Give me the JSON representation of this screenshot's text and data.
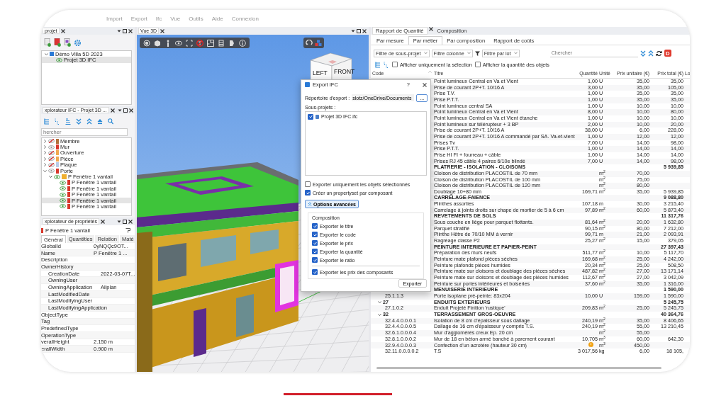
{
  "menu": [
    "Import",
    "Export",
    "Ifc",
    "Vue",
    "Outils",
    "Aide",
    "Connexion"
  ],
  "project_panel": {
    "tab": "projet",
    "tree": [
      {
        "label": "Démo Villa 5D 2023",
        "expanded": true,
        "selected": false,
        "children": [
          {
            "label": "Projet 3D IFC",
            "selected": true
          }
        ]
      }
    ]
  },
  "ifc_explorer": {
    "tab": "xplorateur IFC - Projet 3D ...",
    "search": {
      "placeholder": "hercher"
    },
    "tree": [
      {
        "label": "Membre",
        "visible": false,
        "color": "#b0703a",
        "expanded": false,
        "selected": false
      },
      {
        "label": "Mur",
        "visible": true,
        "color": "#d8382c",
        "expanded": false,
        "selected": false
      },
      {
        "label": "Ouverture",
        "visible": false,
        "color": "#f0a850",
        "expanded": false,
        "selected": false
      },
      {
        "label": "Pièce",
        "visible": false,
        "color": "#f0a850",
        "expanded": false,
        "selected": false
      },
      {
        "label": "Plaque",
        "visible": false,
        "color": "#b8cce8",
        "expanded": false,
        "selected": false
      },
      {
        "label": "Porte",
        "visible": true,
        "color": "#d8382c",
        "expanded": true,
        "selected": false,
        "children": [
          {
            "label": "P Fenêtre 1 vantail",
            "visible": true,
            "color": "#f0b030",
            "expanded": true,
            "selected": false,
            "children": [
              {
                "label": "P Fenêtre 1 vantail",
                "visible": true,
                "color": "#d8382c",
                "selected": false
              },
              {
                "label": "P Fenêtre 1 vantail",
                "visible": true,
                "color": "#d8382c",
                "selected": false
              },
              {
                "label": "P Fenêtre 1 vantail",
                "visible": true,
                "color": "#d8382c",
                "selected": false
              },
              {
                "label": "P Fenêtre 1 vantail",
                "visible": true,
                "color": "#d8382c",
                "selected": true
              },
              {
                "label": "P Fenêtre 1 vantail",
                "visible": true,
                "color": "#d8382c",
                "selected": false
              }
            ]
          }
        ]
      }
    ]
  },
  "properties_panel": {
    "tab": "xplorateur de propriétés",
    "element": "P Fenêtre 1 vantail",
    "tabs": [
      {
        "label": "Général",
        "selected": true
      },
      {
        "label": "Quantities",
        "selected": false
      },
      {
        "label": "Relation",
        "selected": false
      },
      {
        "label": "Maté",
        "selected": false
      }
    ],
    "rows": [
      {
        "name": "GlobalId",
        "value": "0yNQQc9OT..."
      },
      {
        "name": "Name",
        "value": "P Fenêtre 1 ..."
      },
      {
        "name": "Description"
      },
      {
        "name": "OwnerHistory",
        "children": [
          {
            "name": "CreationDate",
            "value": "2022-03-07T..."
          },
          {
            "name": "OwningUser"
          },
          {
            "name": "OwningApplication",
            "value": "Allplan"
          },
          {
            "name": "LastModifiedDate"
          },
          {
            "name": "LastModifyingUser"
          },
          {
            "name": "LastModifyingApplication"
          }
        ]
      },
      {
        "name": "ObjectType"
      },
      {
        "name": "Tag"
      },
      {
        "name": "PredefinedType"
      },
      {
        "name": "OperationType"
      },
      {
        "name": "verallHeight",
        "value": "2.150 m"
      },
      {
        "name": "erallWidth",
        "value": "0.900 m"
      }
    ]
  },
  "view_3d": {
    "tab": "Vue 3D",
    "view_cube": [
      "LEFT",
      "FRONT"
    ]
  },
  "dialog": {
    "title": "Export IFC",
    "help": "?",
    "directory": {
      "label": "Répertoire d'export :",
      "value": "slotz/OneDrive/Documents"
    },
    "browse_button": "...",
    "subprojects_label": "Sous-projets :",
    "subprojects": [
      {
        "label": "Projet 3D IFC.ifc",
        "checked": true
      }
    ],
    "options": [
      {
        "label": "Exporter uniquement les objets sélectionnés",
        "checked": false
      },
      {
        "label": "Créer un propertyset par composant",
        "checked": true
      }
    ],
    "advanced_button": {
      "label": "Options avancées",
      "expanded": true
    },
    "group_title": "Composition",
    "composition": [
      {
        "label": "Exporter le titre",
        "checked": true
      },
      {
        "label": "Exporter le code",
        "checked": true
      },
      {
        "label": "Exporter le prix",
        "checked": true
      },
      {
        "label": "Exporter la quantité",
        "checked": true
      },
      {
        "label": "Exporter le ratio",
        "checked": true
      }
    ],
    "extra": [
      {
        "label": "Exporter les prix des composants",
        "checked": true
      }
    ],
    "export_button": "Exporter"
  },
  "report": {
    "tabs": [
      {
        "label": "Rapport de Quantité",
        "selected": true
      },
      {
        "label": "Composition",
        "selected": false
      }
    ],
    "subtabs": [
      {
        "label": "Par mesure",
        "selected": false
      },
      {
        "label": "Par métier",
        "selected": true
      },
      {
        "label": "Par composition",
        "selected": false
      },
      {
        "label": "Rapport de coûts",
        "selected": false
      }
    ],
    "filters": [
      "Filtre de sous-projet",
      "Filtre colonne",
      "Filtre par lot"
    ],
    "search": {
      "placeholder": "Chercher"
    },
    "badge": "D",
    "options": [
      {
        "label": "Afficher uniquement la sélection",
        "checked": false
      },
      {
        "label": "Afficher la quantité des objets",
        "checked": false
      }
    ],
    "columns": [
      "Code",
      "Titre",
      "Quantité",
      "Unité",
      "Prix unitaire (€)",
      "Prix total (€)",
      "Lo"
    ],
    "rows": [
      {
        "kind": "item",
        "title": "Point lumineux Central en Va et Vient",
        "qty": "1,00",
        "unit": "U",
        "unit_price": "35,00",
        "total": "35,00"
      },
      {
        "kind": "item",
        "title": "Prise de courant 2P+T. 10/16  A",
        "qty": "3,00",
        "unit": "U",
        "unit_price": "35,00",
        "total": "105,00"
      },
      {
        "kind": "item",
        "title": "Prise T.V.",
        "qty": "1,00",
        "unit": "U",
        "unit_price": "35,00",
        "total": "35,00"
      },
      {
        "kind": "item",
        "title": "Prise P.T.T.",
        "qty": "1,00",
        "unit": "U",
        "unit_price": "35,00",
        "total": "35,00"
      },
      {
        "kind": "item",
        "title": "Point lumineux central SA",
        "qty": "1,00",
        "unit": "U",
        "unit_price": "10,00",
        "total": "10,00"
      },
      {
        "kind": "item",
        "title": "Point lumineux Central en Va et Vient",
        "qty": "8,00",
        "unit": "U",
        "unit_price": "10,00",
        "total": "80,00"
      },
      {
        "kind": "item",
        "title": "Point lumineux Central en Va et Vient étanche",
        "qty": "1,00",
        "unit": "U",
        "unit_price": "10,00",
        "total": "10,00"
      },
      {
        "kind": "item",
        "title": "Point lumineux sur télérupteur + 3 BP",
        "qty": "2,00",
        "unit": "U",
        "unit_price": "10,00",
        "total": "20,00"
      },
      {
        "kind": "item",
        "title": "Prise de courant 2P+T. 10/16  A",
        "qty": "38,00",
        "unit": "U",
        "unit_price": "6,00",
        "total": "228,00"
      },
      {
        "kind": "item",
        "title": "Prise de courant 2P+T. 10/16  A commandé par SA. Va-et-vient",
        "qty": "1,00",
        "unit": "U",
        "unit_price": "12,00",
        "total": "12,00"
      },
      {
        "kind": "item",
        "title": "Prises Tv",
        "qty": "7,00",
        "unit": "U",
        "unit_price": "14,00",
        "total": "98,00"
      },
      {
        "kind": "item",
        "title": "Prise P.T.T.",
        "qty": "1,00",
        "unit": "U",
        "unit_price": "14,00",
        "total": "14,00"
      },
      {
        "kind": "item",
        "title": "Prise HI FI + fourreau + câble",
        "qty": "1,00",
        "unit": "U",
        "unit_price": "14,00",
        "total": "14,00"
      },
      {
        "kind": "item",
        "title": "Prises RJ 45 câble 4 paires 6/10e blindé",
        "qty": "7,00",
        "unit": "U",
        "unit_price": "14,00",
        "total": "98,00"
      },
      {
        "kind": "group",
        "title": "PLATRERIE - ISOLATION - CLOISONS",
        "total": "5 939,85"
      },
      {
        "kind": "item",
        "title": "Cloison de distribution PLACOSTIL de 70 mm",
        "unit": "m$^{2}$",
        "unit_price": "70,00"
      },
      {
        "kind": "item",
        "title": "Cloison de distribution PLACOSTIL de 100 mm",
        "unit": "m$^{2}$",
        "unit_price": "75,00"
      },
      {
        "kind": "item",
        "title": "Cloison de distribution PLACOSTIL de 120 mm",
        "unit": "m$^{2}$",
        "unit_price": "80,00"
      },
      {
        "kind": "item",
        "title": "Doublage 10+80 mm",
        "qty": "169,71",
        "unit": "m$^{2}$",
        "unit_price": "35,00",
        "total": "5 939,85"
      },
      {
        "kind": "group",
        "title": "CARRELAGE-FAIENCE",
        "total": "9 088,80"
      },
      {
        "kind": "item",
        "title": "Plinthes assorties",
        "qty": "107,18",
        "unit": "m",
        "unit_price": "30,00",
        "total": "3 215,40"
      },
      {
        "kind": "item",
        "title": "Carrelage à joints droits sur chape de mortier de 5 à 6 cm",
        "qty": "97,89",
        "unit": "m$^{2}$",
        "unit_price": "60,00",
        "total": "5 873,40"
      },
      {
        "kind": "group",
        "title": "REVETEMENTS DE SOLS",
        "total": "11 317,76"
      },
      {
        "kind": "item",
        "title": "Sous couche en liège pour parquet flottants.",
        "qty": "81,64",
        "unit": "m$^{2}$",
        "unit_price": "20,00",
        "total": "1 632,80"
      },
      {
        "kind": "item",
        "title": "Parquet stratifié",
        "qty": "90,15",
        "unit": "m$^{2}$",
        "unit_price": "80,00",
        "total": "7 212,00"
      },
      {
        "kind": "item",
        "title": "Plinthe Hêtre de 70/10 MM à vernir",
        "qty": "99,71",
        "unit": "m",
        "unit_price": "21,00",
        "total": "2 093,91"
      },
      {
        "kind": "item",
        "title": "Ragréage classe P2",
        "qty": "25,27",
        "unit": "m$^{2}$",
        "unit_price": "15,00",
        "total": "379,05"
      },
      {
        "kind": "group",
        "title": "PEINTURE INTERIEURE ET PAPIER-PEINT",
        "total": "27 397,43"
      },
      {
        "kind": "item",
        "title": "Préparation des murs neufs",
        "qty": "511,77",
        "unit": "m$^{2}$",
        "unit_price": "10,00",
        "total": "5 117,70"
      },
      {
        "kind": "item",
        "title": "Peinture mate plafond pièces sèches",
        "qty": "169,68",
        "unit": "m$^{2}$",
        "unit_price": "25,00",
        "total": "4 242,00"
      },
      {
        "kind": "item",
        "title": "Peinture plafonds pièces humides",
        "qty": "20,34",
        "unit": "m$^{2}$",
        "unit_price": "25,00",
        "total": "508,50"
      },
      {
        "kind": "item",
        "title": "Peinture mate sur cloisons et doublage des pièces sèches",
        "qty": "487,82",
        "unit": "m$^{2}$",
        "unit_price": "27,00",
        "total": "13 171,14"
      },
      {
        "kind": "item",
        "title": "Peinture mate sur cloisons et doublage des pièces humides",
        "qty": "112,67",
        "unit": "m$^{2}$",
        "unit_price": "27,00",
        "total": "3 042,09"
      },
      {
        "kind": "item",
        "title": "Peinture sur portes intérieures et boiseries",
        "qty": "37,60",
        "unit": "m$^{2}$",
        "unit_price": "35,00",
        "total": "1 316,00"
      },
      {
        "kind": "group",
        "title": "MENUISERIE INTERIEURE",
        "total": "1 590,00"
      },
      {
        "kind": "item",
        "code": "25.1.1.3",
        "title": "Porte isoplane pré-peinte: 83x204",
        "qty": "10,00",
        "unit": "U",
        "unit_price": "159,00",
        "total": "1 590,00"
      },
      {
        "kind": "group",
        "code": "27",
        "expanded": true,
        "title": "ENDUITS EXTERIEURS",
        "total": "5 245,75"
      },
      {
        "kind": "item",
        "code": "27.1.0.2",
        "title": "Enduit Projeté Finition 'rustique'",
        "qty": "209,83",
        "unit": "m$^{2}$",
        "unit_price": "25,00",
        "total": "5 245,75"
      },
      {
        "kind": "group",
        "code": "32",
        "expanded": true,
        "title": "TERRASSEMENT GROS-OEUVRE",
        "total": "40 364,76"
      },
      {
        "kind": "item",
        "code": "32.4.4.0.0.0.1",
        "title": "Isolation de 8 cm d'épaisseur sous dallage",
        "qty": "240,19",
        "unit": "m$^{2}$",
        "unit_price": "35,00",
        "total": "8 406,65"
      },
      {
        "kind": "item",
        "code": "32.4.4.0.0.0.5",
        "title": "Dallage de 16 cm d'épaisseur y compris T.S.",
        "qty": "240,19",
        "unit": "m$^{2}$",
        "unit_price": "55,00",
        "total": "13 210,45"
      },
      {
        "kind": "item",
        "code": "32.6.1.0.0.0.4",
        "title": "Mur d'agglomérés creux Ep. 20 cm",
        "unit": "m$^{2}$",
        "unit_price": "55,00"
      },
      {
        "kind": "item",
        "code": "32.8.1.0.0.0.2",
        "title": "Mur de 18 en béton armé banché à parement courant",
        "qty": "10,705",
        "unit": "m$^{3}$",
        "unit_price": "60,00",
        "total": "642,30"
      },
      {
        "kind": "item",
        "code": "32.9.4.0.0.0.3",
        "title": "Confection d'un acrotère (hauteur 30 cm)",
        "warning": true,
        "unit": "m$^{3}$",
        "unit_price": "450,00"
      },
      {
        "kind": "item",
        "code": "32.11.0.0.0.0.2",
        "title": "T.S",
        "qty": "3 017,56",
        "unit": "kg",
        "unit_price": "6,00",
        "total": "18 105,"
      }
    ]
  }
}
